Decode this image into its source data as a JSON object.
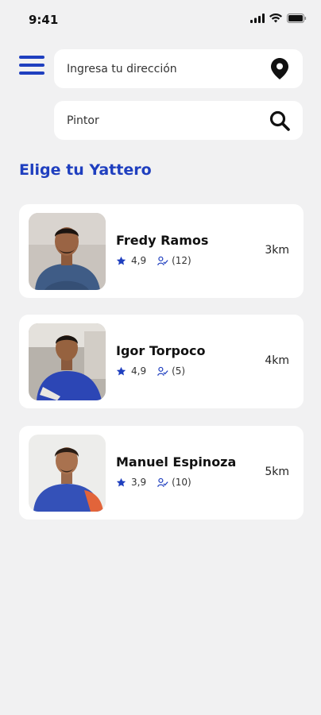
{
  "status": {
    "time": "9:41"
  },
  "header": {
    "address_placeholder": "Ingresa tu dirección",
    "search_value": "Pintor"
  },
  "section_title": "Elige tu Yattero",
  "workers": [
    {
      "name": "Fredy Ramos",
      "rating": "4,9",
      "jobs": "(12)",
      "distance": "3km"
    },
    {
      "name": "Igor Torpoco",
      "rating": "4,9",
      "jobs": "(5)",
      "distance": "4km"
    },
    {
      "name": "Manuel Espinoza",
      "rating": "3,9",
      "jobs": "(10)",
      "distance": "5km"
    }
  ],
  "colors": {
    "accent": "#1f3fbf",
    "background": "#f1f1f2",
    "card": "#ffffff"
  },
  "icons": [
    "menu-icon",
    "location-pin-icon",
    "search-icon",
    "star-icon",
    "jobs-icon",
    "signal-icon",
    "wifi-icon",
    "battery-icon"
  ]
}
